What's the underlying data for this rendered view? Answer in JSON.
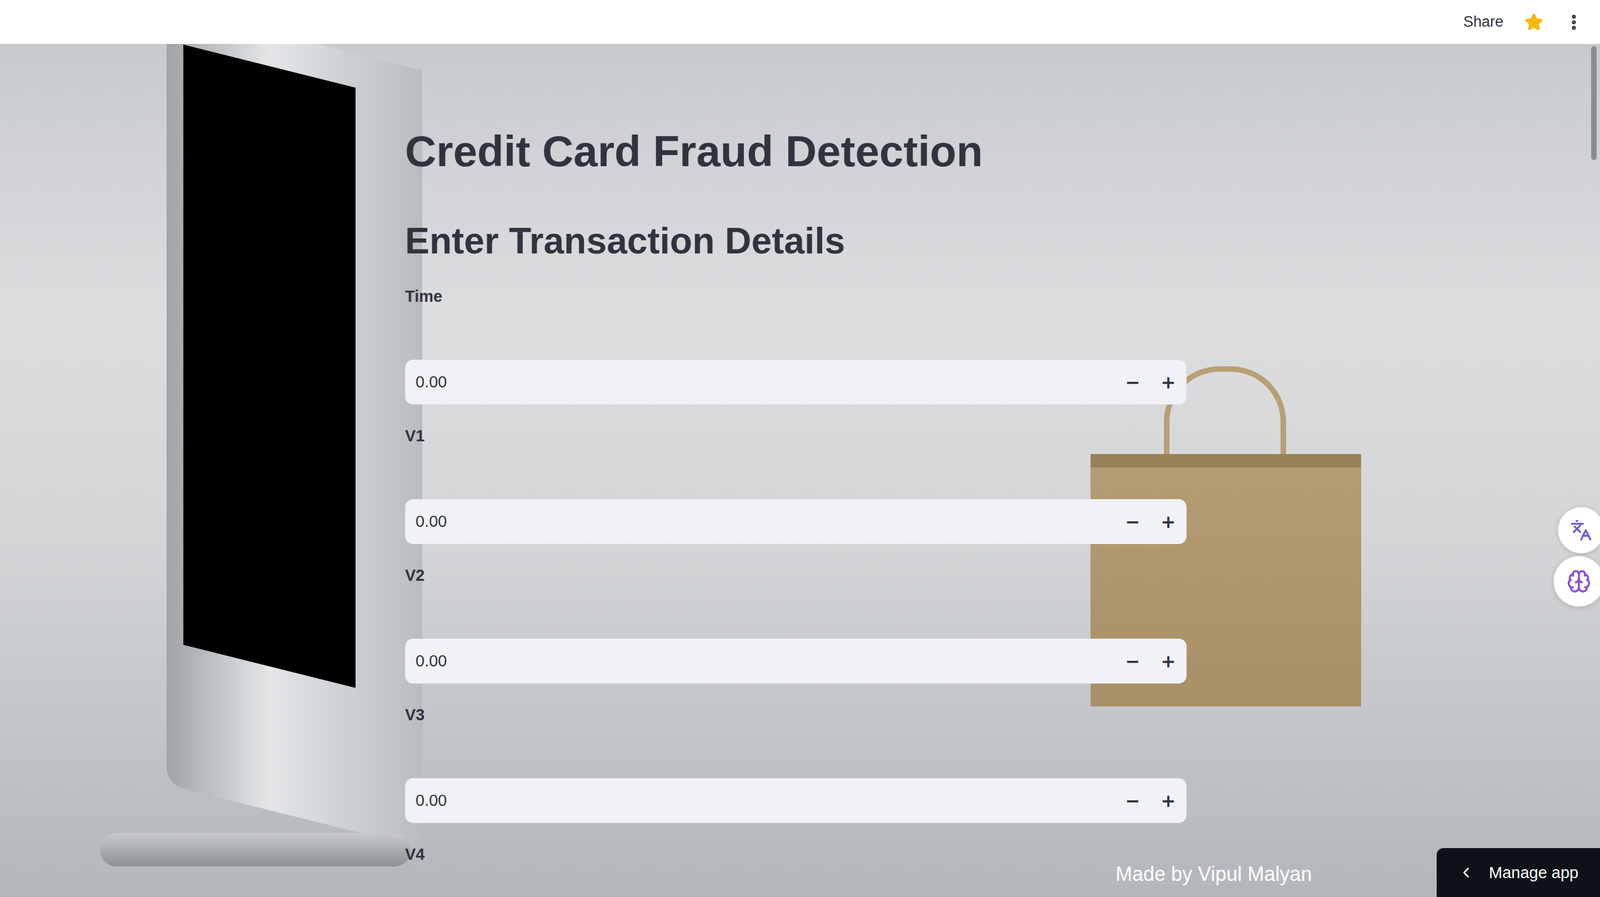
{
  "header": {
    "share": "Share",
    "starred": true
  },
  "title": "Credit Card Fraud Detection",
  "subtitle": "Enter Transaction Details",
  "stepper": {
    "decrement": "−",
    "increment": "+"
  },
  "fields": [
    {
      "label": "Time",
      "value": "0.00"
    },
    {
      "label": "V1",
      "value": "0.00"
    },
    {
      "label": "V2",
      "value": "0.00"
    },
    {
      "label": "V3",
      "value": "0.00"
    },
    {
      "label": "V4"
    }
  ],
  "footer": {
    "credit": "Made by Vipul Malyan"
  },
  "manage": {
    "label": "Manage app"
  }
}
